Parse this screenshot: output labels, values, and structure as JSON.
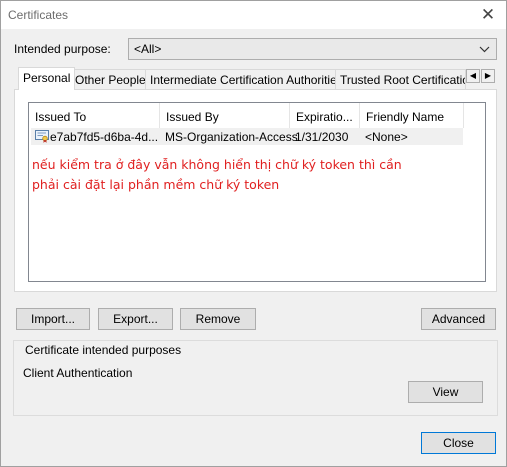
{
  "window": {
    "title": "Certificates",
    "close_glyph": "✕"
  },
  "purpose": {
    "label": "Intended purpose:",
    "value": "<All>"
  },
  "tabs": [
    {
      "label": "Personal"
    },
    {
      "label": "Other People"
    },
    {
      "label": "Intermediate Certification Authorities"
    },
    {
      "label": "Trusted Root Certification"
    }
  ],
  "tab_scroll": {
    "left": "◀",
    "right": "▶"
  },
  "list": {
    "columns": [
      "Issued To",
      "Issued By",
      "Expiratio...",
      "Friendly Name"
    ],
    "rows": [
      {
        "issued_to": "e7ab7fd5-d6ba-4d...",
        "issued_by": "MS-Organization-Access",
        "expiration": "1/31/2030",
        "friendly_name": "<None>"
      }
    ]
  },
  "note": {
    "line1": "nếu kiểm tra ở đây vẫn không hiển thị chữ ký token thì cần",
    "line2": "phải cài đặt lại phần mềm chữ ký token",
    "color": "#e02020"
  },
  "buttons": {
    "import": "Import...",
    "export": "Export...",
    "remove": "Remove",
    "advanced": "Advanced",
    "view": "View",
    "close": "Close"
  },
  "purposes_group": {
    "label": "Certificate intended purposes",
    "value": "Client Authentication"
  },
  "icons": {
    "close": "close-icon",
    "dropdown": "chevron-down-icon",
    "certificate": "certificate-icon"
  }
}
